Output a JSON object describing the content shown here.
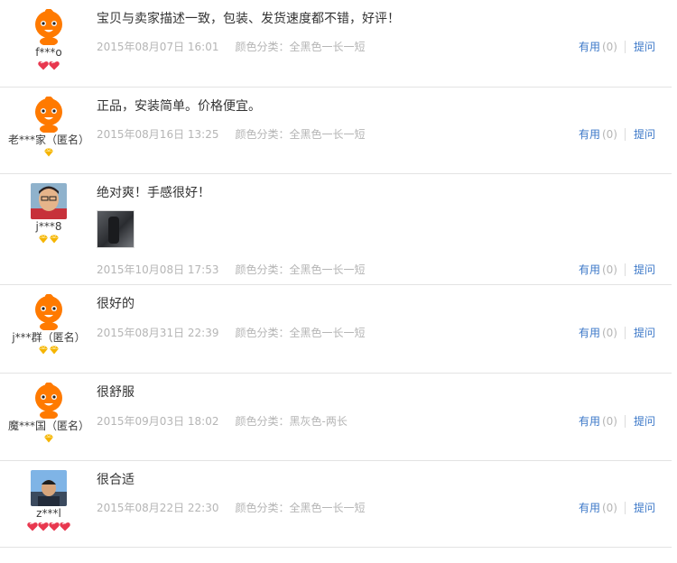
{
  "reviews": [
    {
      "username": "f***o",
      "avatar_icon": "taobao-doll-avatar-icon",
      "level_icon": "red-heart-icon",
      "level_count": 2,
      "content": "宝贝与卖家描述一致，包装、发货速度都不错，好评！",
      "date": "2015年08月07日 16:01",
      "sku": "颜色分类：全黑色一长一短",
      "useful_label": "有用",
      "useful_count": "(0)",
      "ask_label": "提问"
    },
    {
      "username": "老***家（匿名）",
      "avatar_icon": "taobao-doll-avatar-icon",
      "level_icon": "yellow-diamond-icon",
      "level_count": 1,
      "content": "正品，安装简单。价格便宜。",
      "date": "2015年08月16日 13:25",
      "sku": "颜色分类：全黑色一长一短",
      "useful_label": "有用",
      "useful_count": "(0)",
      "ask_label": "提问"
    },
    {
      "username": "j***8",
      "avatar_icon": "user-photo-avatar-icon",
      "level_icon": "yellow-diamond-icon",
      "level_count": 2,
      "content": "绝对爽！手感很好！",
      "date": "2015年10月08日 17:53",
      "sku": "颜色分类：全黑色一长一短",
      "useful_label": "有用",
      "useful_count": "(0)",
      "ask_label": "提问"
    },
    {
      "username": "j***群（匿名）",
      "avatar_icon": "taobao-doll-avatar-icon",
      "level_icon": "yellow-diamond-icon",
      "level_count": 2,
      "content": "很好的",
      "date": "2015年08月31日 22:39",
      "sku": "颜色分类：全黑色一长一短",
      "useful_label": "有用",
      "useful_count": "(0)",
      "ask_label": "提问"
    },
    {
      "username": "魔***国（匿名）",
      "avatar_icon": "taobao-doll-avatar-icon",
      "level_icon": "yellow-diamond-icon",
      "level_count": 1,
      "content": "很舒服",
      "date": "2015年09月03日 18:02",
      "sku": "颜色分类：黑灰色-两长",
      "useful_label": "有用",
      "useful_count": "(0)",
      "ask_label": "提问"
    },
    {
      "username": "z***l",
      "avatar_icon": "user-photo-avatar-icon",
      "level_icon": "red-heart-icon",
      "level_count": 4,
      "content": "很合适",
      "date": "2015年08月22日 22:30",
      "sku": "颜色分类：全黑色一长一短",
      "useful_label": "有用",
      "useful_count": "(0)",
      "ask_label": "提问"
    }
  ],
  "colors": {
    "link": "#3c78c8",
    "meta": "#b5b5b5",
    "divider": "#e3e3e3",
    "heart": "#e8384f",
    "diamond": "#f5b400",
    "doll": "#ff7a00"
  }
}
